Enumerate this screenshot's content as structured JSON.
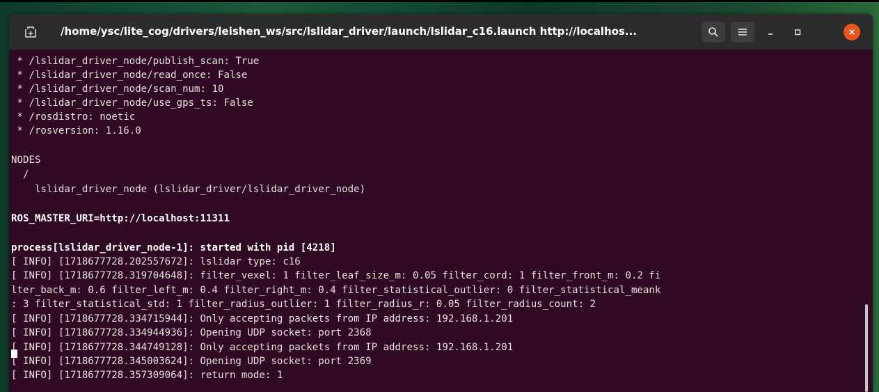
{
  "window": {
    "title": "/home/ysc/lite_cog/drivers/leishen_ws/src/lslidar_driver/launch/lslidar_c16.launch http://localhos...",
    "buttons": {
      "new_tab_icon": "new-tab-icon",
      "search_icon": "search-icon",
      "menu_icon": "hamburger-menu-icon",
      "minimize_icon": "minimize-icon",
      "maximize_icon": "maximize-icon",
      "close_icon": "close-icon"
    }
  },
  "colors": {
    "terminal_bg": "#300a24",
    "titlebar_bg": "#2c2c2c",
    "close_button": "#e95420",
    "text": "#e6e1dc"
  },
  "terminal": {
    "lines": [
      " * /lslidar_driver_node/publish_scan: True",
      " * /lslidar_driver_node/read_once: False",
      " * /lslidar_driver_node/scan_num: 10",
      " * /lslidar_driver_node/use_gps_ts: False",
      " * /rosdistro: noetic",
      " * /rosversion: 1.16.0",
      "",
      "NODES",
      "  /",
      "    lslidar_driver_node (lslidar_driver/lslidar_driver_node)",
      "",
      "ROS_MASTER_URI=http://localhost:11311",
      "",
      "process[lslidar_driver_node-1]: started with pid [4218]",
      "[ INFO] [1718677728.202557672]: lslidar type: c16",
      "[ INFO] [1718677728.319704648]: filter_vexel: 1 filter_leaf_size_m: 0.05 filter_cord: 1 filter_front_m: 0.2 fi",
      "lter_back_m: 0.6 filter_left_m: 0.4 filter_right_m: 0.4 filter_statistical_outlier: 0 filter_statistical_meank",
      ": 3 filter_statistical_std: 1 filter_radius_outlier: 1 filter_radius_r: 0.05 filter_radius_count: 2",
      "[ INFO] [1718677728.334715944]: Only accepting packets from IP address: 192.168.1.201",
      "[ INFO] [1718677728.334944936]: Opening UDP socket: port 2368",
      "[ INFO] [1718677728.344749128]: Only accepting packets from IP address: 192.168.1.201",
      "[ INFO] [1718677728.345003624]: Opening UDP socket: port 2369",
      "[ INFO] [1718677728.357309064]: return mode: 1"
    ]
  }
}
